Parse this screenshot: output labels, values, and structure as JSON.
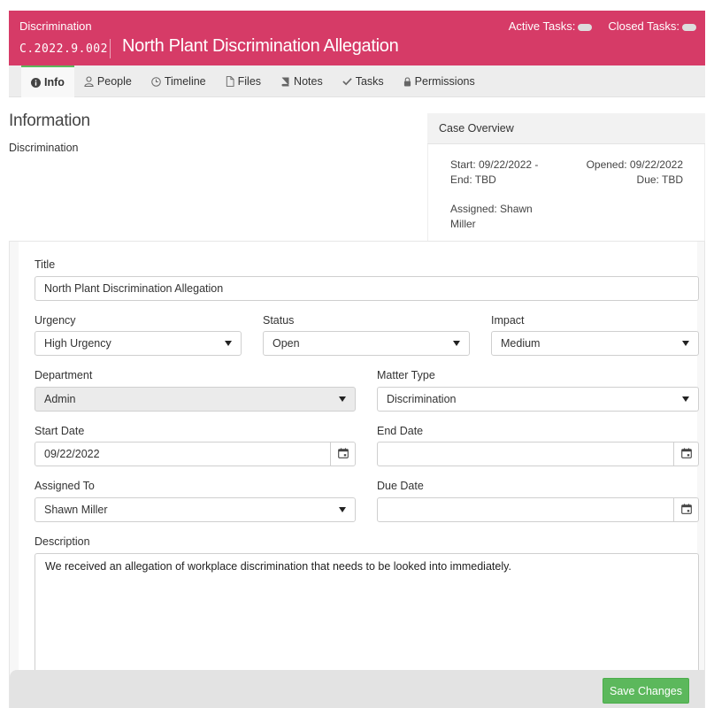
{
  "header": {
    "category": "Discrimination",
    "case_id": "C.2022.9.002",
    "title": "North Plant Discrimination Allegation",
    "active_tasks_label": "Active Tasks:",
    "closed_tasks_label": "Closed Tasks:",
    "bg_color": "#d63b67"
  },
  "tabs": [
    {
      "label": "Info",
      "icon": "info-circle-icon",
      "active": true
    },
    {
      "label": "People",
      "icon": "user-icon"
    },
    {
      "label": "Timeline",
      "icon": "clock-icon"
    },
    {
      "label": "Files",
      "icon": "file-icon"
    },
    {
      "label": "Notes",
      "icon": "book-icon"
    },
    {
      "label": "Tasks",
      "icon": "check-icon"
    },
    {
      "label": "Permissions",
      "icon": "lock-icon"
    }
  ],
  "info": {
    "heading": "Information",
    "subheading": "Discrimination"
  },
  "overview": {
    "title": "Case Overview",
    "start": "Start: 09/22/2022 -",
    "end": "End: TBD",
    "opened": "Opened: 09/22/2022",
    "due": "Due: TBD",
    "assigned": "Assigned: Shawn Miller"
  },
  "form": {
    "title_label": "Title",
    "title_value": "North Plant Discrimination Allegation",
    "urgency_label": "Urgency",
    "urgency_value": "High Urgency",
    "status_label": "Status",
    "status_value": "Open",
    "impact_label": "Impact",
    "impact_value": "Medium",
    "department_label": "Department",
    "department_value": "Admin",
    "matter_type_label": "Matter Type",
    "matter_type_value": "Discrimination",
    "start_date_label": "Start Date",
    "start_date_value": "09/22/2022",
    "end_date_label": "End Date",
    "end_date_value": "",
    "assigned_to_label": "Assigned To",
    "assigned_to_value": "Shawn Miller",
    "due_date_label": "Due Date",
    "due_date_value": "",
    "description_label": "Description",
    "description_value": "We received an allegation of workplace discrimination that needs to be looked into immediately."
  },
  "footer": {
    "save_label": "Save Changes",
    "save_color": "#5cb85c"
  }
}
